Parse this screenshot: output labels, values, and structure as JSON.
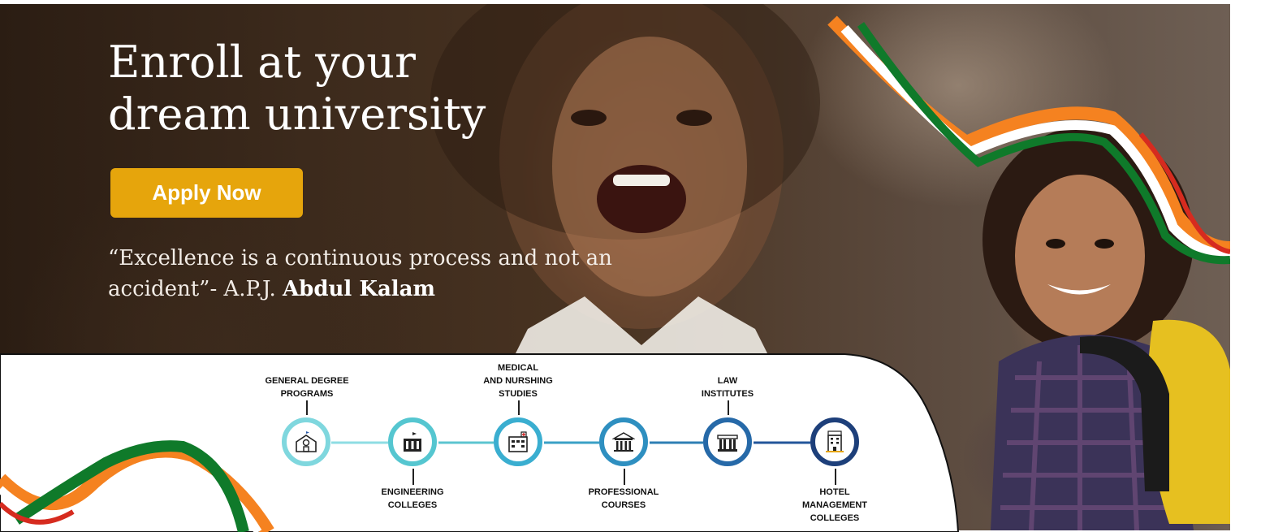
{
  "hero": {
    "title": "Enroll at your\ndream university",
    "apply_label": "Apply Now",
    "quote_text": "“Excellence is a continuous process and not an accident”- A.P.J. ",
    "quote_author": "Abdul Kalam"
  },
  "programs": [
    {
      "label": "GENERAL DEGREE\nPROGRAMS",
      "icon": "school-building-icon"
    },
    {
      "label": "ENGINEERING\nCOLLEGES",
      "icon": "engineering-college-icon"
    },
    {
      "label": "MEDICAL\nAND NURSHING\nSTUDIES",
      "icon": "hospital-icon"
    },
    {
      "label": "PROFESSIONAL\nCOURSES",
      "icon": "institute-building-icon"
    },
    {
      "label": "LAW\nINSTITUTES",
      "icon": "courthouse-icon"
    },
    {
      "label": "HOTEL\nMANAGEMENT\nCOLLEGES",
      "icon": "hotel-icon"
    }
  ],
  "colors": {
    "button": "#e6a50c",
    "saffron": "#f58220",
    "green": "#0f7a2a",
    "ring_1": "#5fd0d8",
    "ring_6": "#1d3f7a"
  }
}
